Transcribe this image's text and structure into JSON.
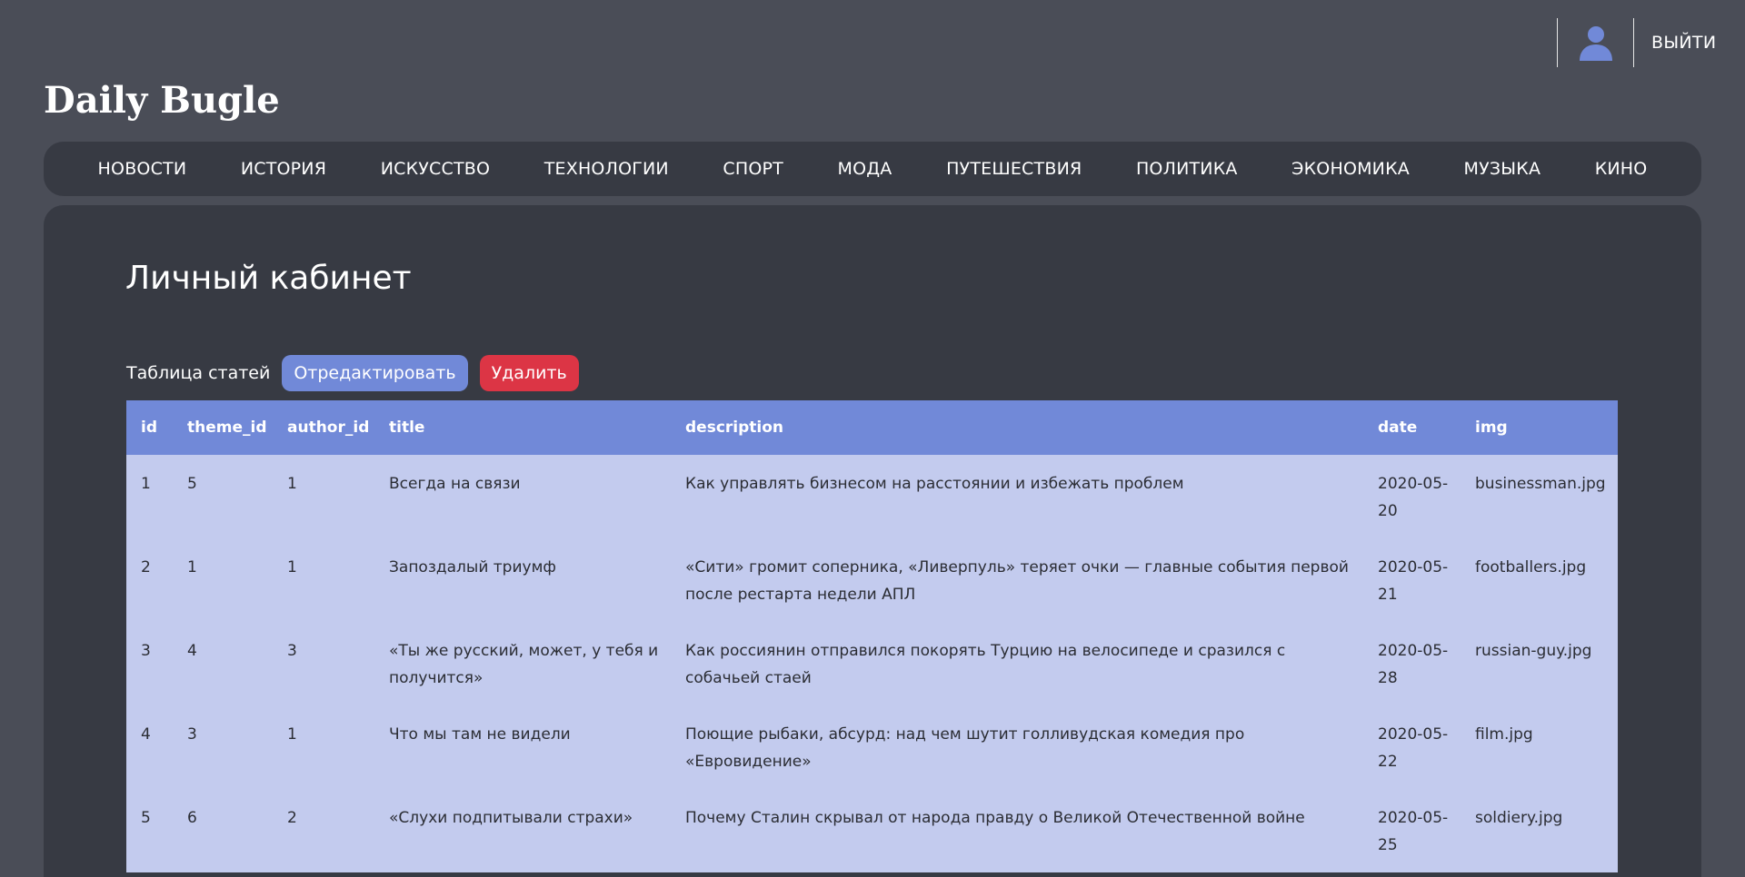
{
  "header": {
    "logout_label": "ВЫЙТИ",
    "user_icon": "user-icon"
  },
  "brand": {
    "name": "Daily Bugle"
  },
  "nav": {
    "items": [
      {
        "label": "НОВОСТИ"
      },
      {
        "label": "ИСТОРИЯ"
      },
      {
        "label": "ИСКУССТВО"
      },
      {
        "label": "ТЕХНОЛОГИИ"
      },
      {
        "label": "СПОРТ"
      },
      {
        "label": "МОДА"
      },
      {
        "label": "ПУТЕШЕСТВИЯ"
      },
      {
        "label": "ПОЛИТИКА"
      },
      {
        "label": "ЭКОНОМИКА"
      },
      {
        "label": "МУЗЫКА"
      },
      {
        "label": "КИНО"
      }
    ]
  },
  "main": {
    "title": "Личный кабинет",
    "toolbar": {
      "label": "Таблица статей",
      "edit_label": "Отредактировать",
      "delete_label": "Удалить"
    },
    "table": {
      "columns": [
        "id",
        "theme_id",
        "author_id",
        "title",
        "description",
        "date",
        "img"
      ],
      "rows": [
        {
          "id": "1",
          "theme_id": "5",
          "author_id": "1",
          "title": "Всегда на связи",
          "description": "Как управлять бизнесом на расстоянии и избежать проблем",
          "date": "2020-05-20",
          "img": "businessman.jpg"
        },
        {
          "id": "2",
          "theme_id": "1",
          "author_id": "1",
          "title": "Запоздалый триумф",
          "description": "«Сити» громит соперника, «Ливерпуль» теряет очки — главные события первой после рестарта недели АПЛ",
          "date": "2020-05-21",
          "img": "footballers.jpg"
        },
        {
          "id": "3",
          "theme_id": "4",
          "author_id": "3",
          "title": "«Ты же русский, может, у тебя и получится»",
          "description": "Как россиянин отправился покорять Турцию на велосипеде и сразился с собачьей стаей",
          "date": "2020-05-28",
          "img": "russian-guy.jpg"
        },
        {
          "id": "4",
          "theme_id": "3",
          "author_id": "1",
          "title": "Что мы там не видели",
          "description": "Поющие рыбаки, абсурд: над чем шутит голливудская комедия про «Евровидение»",
          "date": "2020-05-22",
          "img": "film.jpg"
        },
        {
          "id": "5",
          "theme_id": "6",
          "author_id": "2",
          "title": "«Слухи подпитывали страхи»",
          "description": "Почему Сталин скрывал от народа правду о Великой Отечественной войне",
          "date": "2020-05-25",
          "img": "soldiery.jpg"
        }
      ]
    }
  },
  "colors": {
    "page_bg": "#4a4d57",
    "panel_bg": "#373a43",
    "accent": "#7189d8",
    "danger": "#dc3545",
    "table_row_bg": "#c3cbee"
  }
}
